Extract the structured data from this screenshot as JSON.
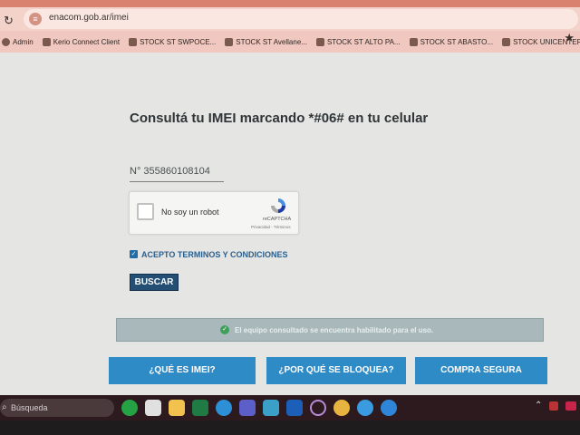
{
  "browser": {
    "url": "enacom.gob.ar/imei",
    "bookmarks": [
      {
        "label": "Admin"
      },
      {
        "label": "Kerio Connect Client"
      },
      {
        "label": "STOCK ST SWPOCE..."
      },
      {
        "label": "STOCK ST Avellane..."
      },
      {
        "label": "STOCK ST ALTO PA..."
      },
      {
        "label": "STOCK ST ABASTO..."
      },
      {
        "label": "STOCK UNICENTER..."
      }
    ]
  },
  "form": {
    "headline": "Consultá tu IMEI marcando *#06# en tu celular",
    "imei_value": "N°  355860108104",
    "captcha_label": "No soy un robot",
    "recaptcha_brand": "reCAPTCHA",
    "recaptcha_links": "Privacidad - Términos",
    "terms_label": "ACEPTO TERMINOS Y CONDICIONES",
    "search_button": "BUSCAR",
    "result_message": "El equipo consultado se encuentra habilitado para el uso."
  },
  "info_buttons": [
    {
      "label": "¿QUÉ ES IMEI?"
    },
    {
      "label": "¿POR QUÉ SE BLOQUEA?"
    },
    {
      "label": "COMPRA SEGURA"
    }
  ],
  "taskbar": {
    "search_placeholder": "Búsqueda",
    "icons": [
      "whatsapp-icon",
      "store-icon",
      "file-explorer-icon",
      "excel-icon",
      "edge-icon",
      "teams-icon",
      "app-icon",
      "outlook-icon",
      "circle-app-icon",
      "chrome-icon",
      "edge-dev-icon",
      "edge-beta-icon"
    ]
  },
  "colors": {
    "primary_button": "#2f8bc6",
    "search_button": "#244e74",
    "terms_text": "#2a5e8c"
  }
}
